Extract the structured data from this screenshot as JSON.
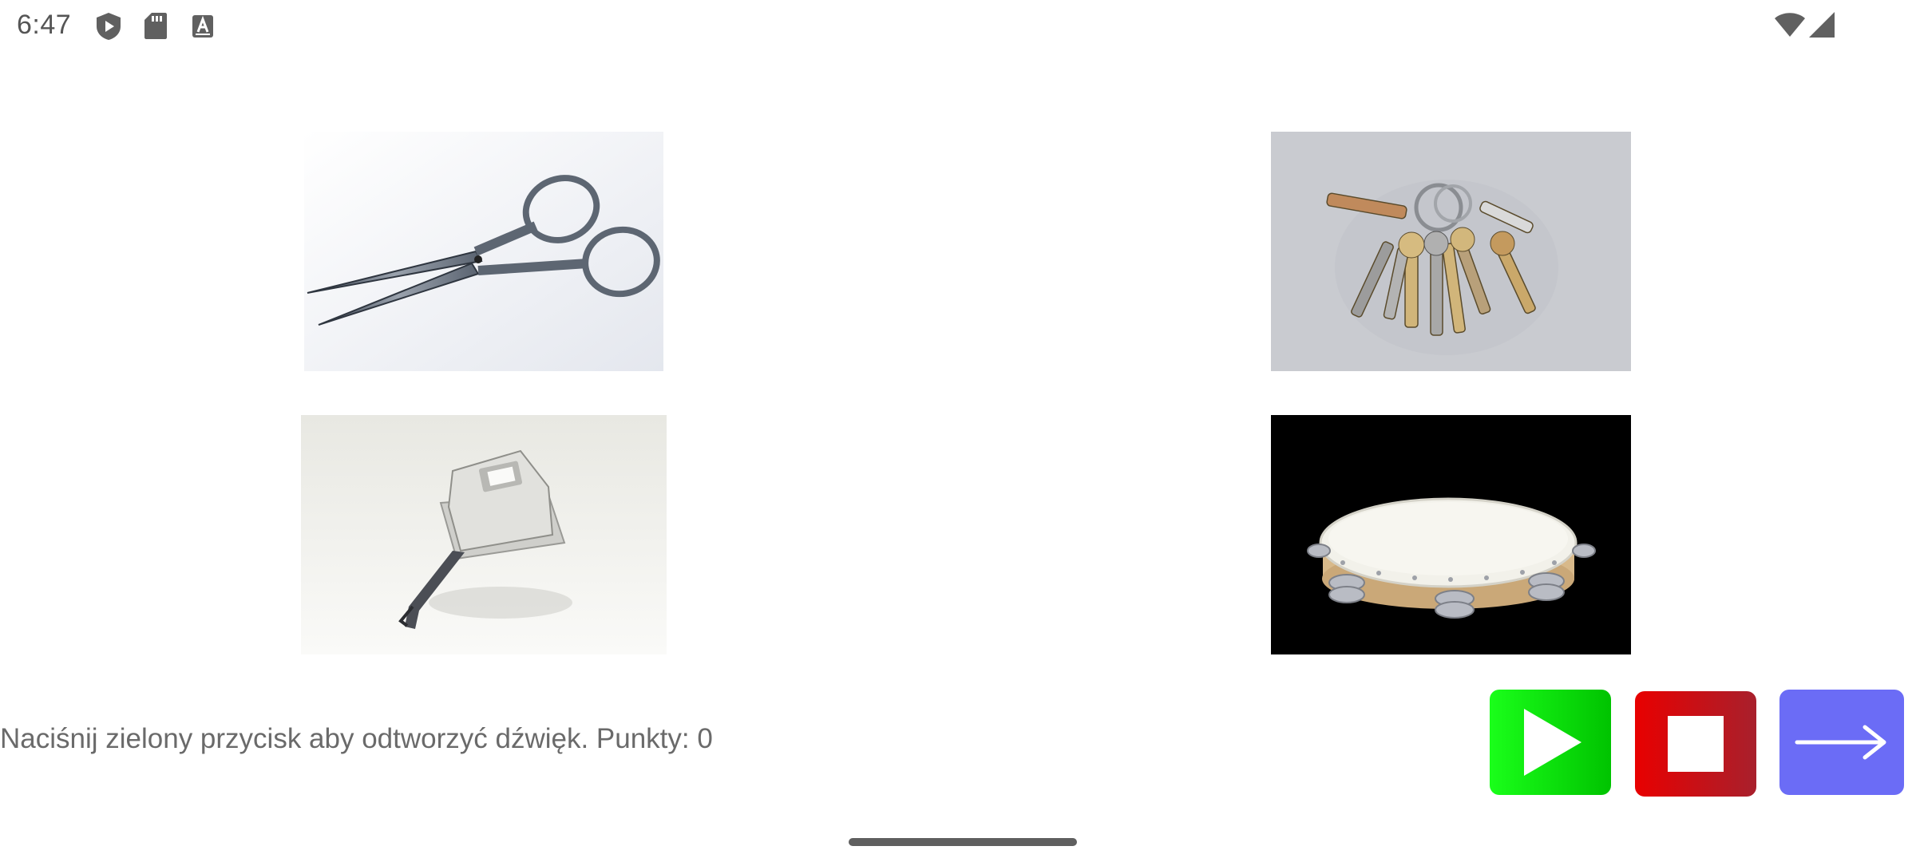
{
  "status_bar": {
    "time": "6:47",
    "left_icons": [
      "shield-play-icon",
      "sd-card-icon",
      "text-a-icon"
    ],
    "right_icons": [
      "wifi-icon",
      "cell-signal-icon"
    ]
  },
  "tiles": [
    {
      "name": "scissors",
      "icon": "scissors-image"
    },
    {
      "name": "keys",
      "icon": "keys-image"
    },
    {
      "name": "hole-punch",
      "icon": "hole-punch-image"
    },
    {
      "name": "tambourine",
      "icon": "tambourine-image"
    }
  ],
  "footer": {
    "instruction": "Naciśnij zielony przycisk aby odtworzyć dźwięk. Punkty: 0"
  },
  "controls": {
    "play": {
      "icon": "play-icon",
      "color": "#00d400"
    },
    "stop": {
      "icon": "stop-icon",
      "color": "#e00000"
    },
    "next": {
      "icon": "arrow-right-icon",
      "color": "#6b6cf6"
    }
  }
}
